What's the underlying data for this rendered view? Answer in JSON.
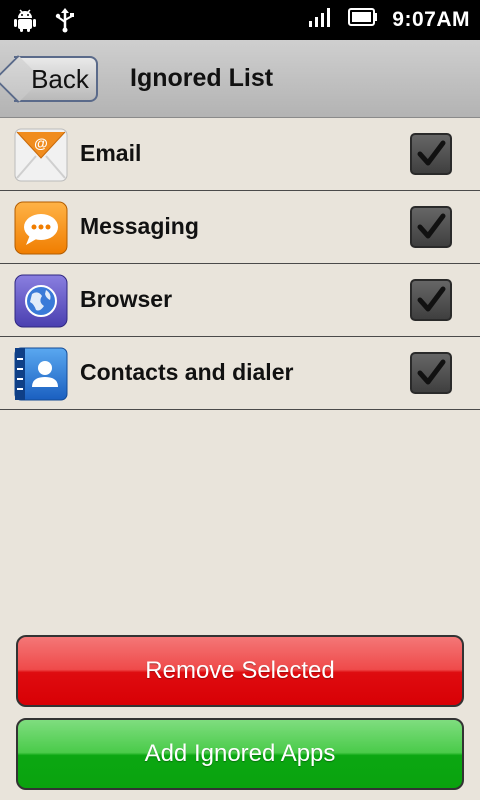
{
  "status_bar": {
    "time": "9:07AM",
    "icons": [
      "android-icon",
      "usb-icon",
      "signal-icon",
      "battery-icon"
    ]
  },
  "header": {
    "back_label": "Back",
    "title": "Ignored List"
  },
  "apps": [
    {
      "label": "Email",
      "icon": "email-icon",
      "checked": true
    },
    {
      "label": "Messaging",
      "icon": "messaging-icon",
      "checked": true
    },
    {
      "label": "Browser",
      "icon": "browser-icon",
      "checked": true
    },
    {
      "label": "Contacts and dialer",
      "icon": "contacts-icon",
      "checked": true
    }
  ],
  "actions": {
    "remove_label": "Remove Selected",
    "add_label": "Add Ignored Apps"
  },
  "colors": {
    "remove_button": "#e00a0e",
    "add_button": "#0ba712",
    "background": "#e9e4db",
    "status_bar": "#000000"
  }
}
